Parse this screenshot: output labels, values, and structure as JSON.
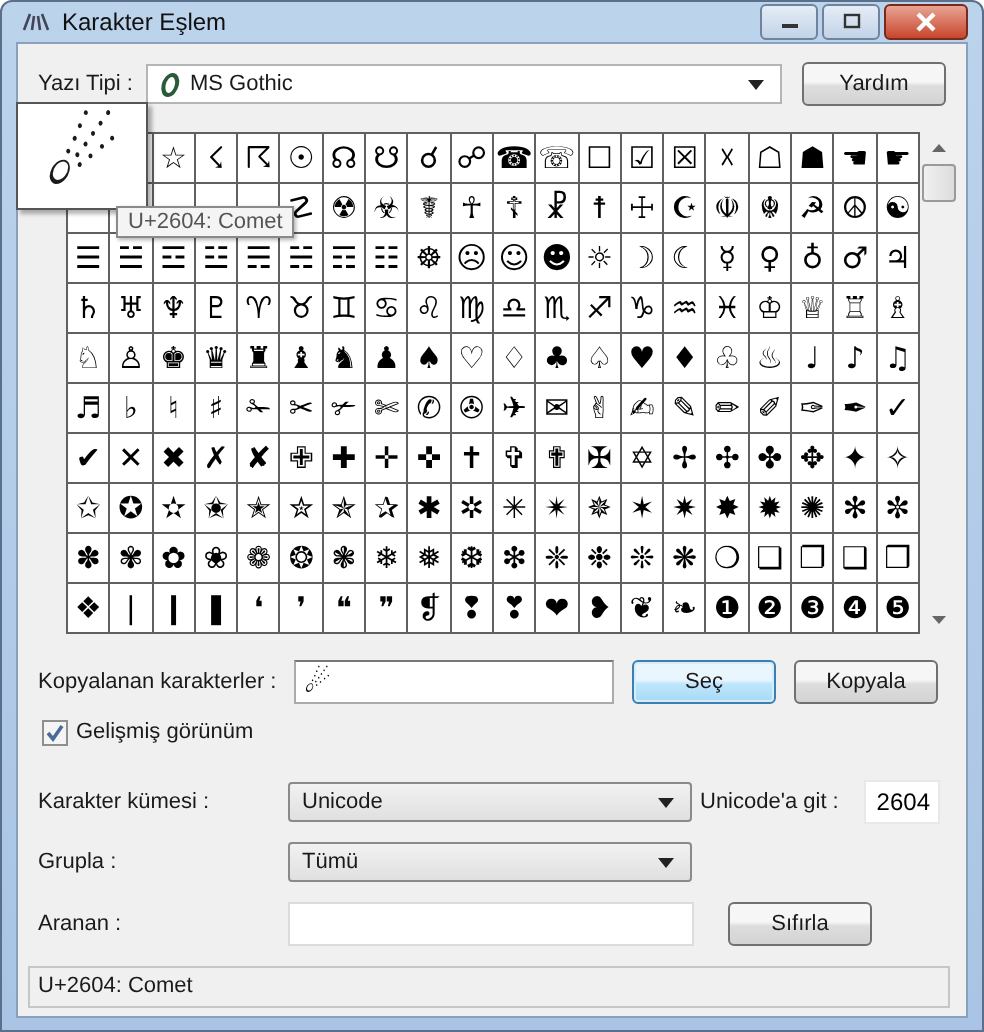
{
  "window": {
    "title": "Karakter Eşlem"
  },
  "font": {
    "label": "Yazı Tipi :",
    "value": "MS Gothic"
  },
  "help_button": "Yardım",
  "grid": {
    "rows": [
      {
        "cells": [
          "",
          "",
          "☆",
          "☇",
          "☈",
          "☉",
          "☊",
          "☋",
          "☌",
          "☍",
          "☎",
          "☏",
          "☐",
          "☑",
          "☒",
          "☓",
          "☖",
          "☗",
          "☚",
          "☛"
        ]
      },
      {
        "cells": [
          "",
          "",
          "",
          "",
          "",
          "☡",
          "☢",
          "☣",
          "☤",
          "☥",
          "☦",
          "☧",
          "☨",
          "☩",
          "☪",
          "☫",
          "☬",
          "☭",
          "☮",
          "☯"
        ]
      },
      {
        "cells": [
          "☰",
          "☱",
          "☲",
          "☳",
          "☴",
          "☵",
          "☶",
          "☷",
          "☸",
          "☹",
          "☺",
          "☻",
          "☼",
          "☽",
          "☾",
          "☿",
          "♀",
          "♁",
          "♂",
          "♃"
        ]
      },
      {
        "cells": [
          "♄",
          "♅",
          "♆",
          "♇",
          "♈",
          "♉",
          "♊",
          "♋",
          "♌",
          "♍",
          "♎",
          "♏",
          "♐",
          "♑",
          "♒",
          "♓",
          "♔",
          "♕",
          "♖",
          "♗"
        ]
      },
      {
        "cells": [
          "♘",
          "♙",
          "♚",
          "♛",
          "♜",
          "♝",
          "♞",
          "♟",
          "♠",
          "♡",
          "♢",
          "♣",
          "♤",
          "♥",
          "♦",
          "♧",
          "♨",
          "♩",
          "♪",
          "♫"
        ]
      },
      {
        "cells": [
          "♬",
          "♭",
          "♮",
          "♯",
          "✁",
          "✂",
          "✃",
          "✄",
          "✆",
          "✇",
          "✈",
          "✉",
          "✌",
          "✍",
          "✎",
          "✏",
          "✐",
          "✑",
          "✒",
          "✓"
        ]
      },
      {
        "cells": [
          "✔",
          "✕",
          "✖",
          "✗",
          "✘",
          "✙",
          "✚",
          "✛",
          "✜",
          "✝",
          "✞",
          "✟",
          "✠",
          "✡",
          "✢",
          "✣",
          "✤",
          "✥",
          "✦",
          "✧"
        ]
      },
      {
        "cells": [
          "✩",
          "✪",
          "✫",
          "✬",
          "✭",
          "✮",
          "✯",
          "✰",
          "✱",
          "✲",
          "✳",
          "✴",
          "✵",
          "✶",
          "✷",
          "✸",
          "✹",
          "✺",
          "✻",
          "✼"
        ]
      },
      {
        "cells": [
          "✽",
          "✾",
          "✿",
          "❀",
          "❁",
          "❂",
          "❃",
          "❄",
          "❅",
          "❆",
          "❇",
          "❈",
          "❉",
          "❊",
          "❋",
          "❍",
          "❏",
          "❐",
          "❑",
          "❒"
        ]
      },
      {
        "cells": [
          "❖",
          "❘",
          "❙",
          "❚",
          "❛",
          "❜",
          "❝",
          "❞",
          "❡",
          "❢",
          "❣",
          "❤",
          "❥",
          "❦",
          "❧",
          "❶",
          "❷",
          "❸",
          "❹",
          "❺"
        ]
      }
    ]
  },
  "magnifier": {
    "glyph": "☄"
  },
  "tooltip": "U+2604: Comet",
  "copy": {
    "label": "Kopyalanan karakterler :",
    "value": "☄"
  },
  "copy_buttons": [
    {
      "label": "Seç",
      "focused": true
    },
    {
      "label": "Kopyala",
      "focused": false
    }
  ],
  "advanced_view": {
    "label": "Gelişmiş görünüm",
    "checked": true
  },
  "charset": {
    "label": "Karakter kümesi :",
    "value": "Unicode"
  },
  "goto": {
    "label": "Unicode'a git :",
    "value": "2604"
  },
  "group": {
    "label": "Grupla :",
    "value": "Tümü"
  },
  "search": {
    "label": "Aranan :",
    "button": "Sıfırla"
  },
  "status_bar": "U+2604: Comet"
}
